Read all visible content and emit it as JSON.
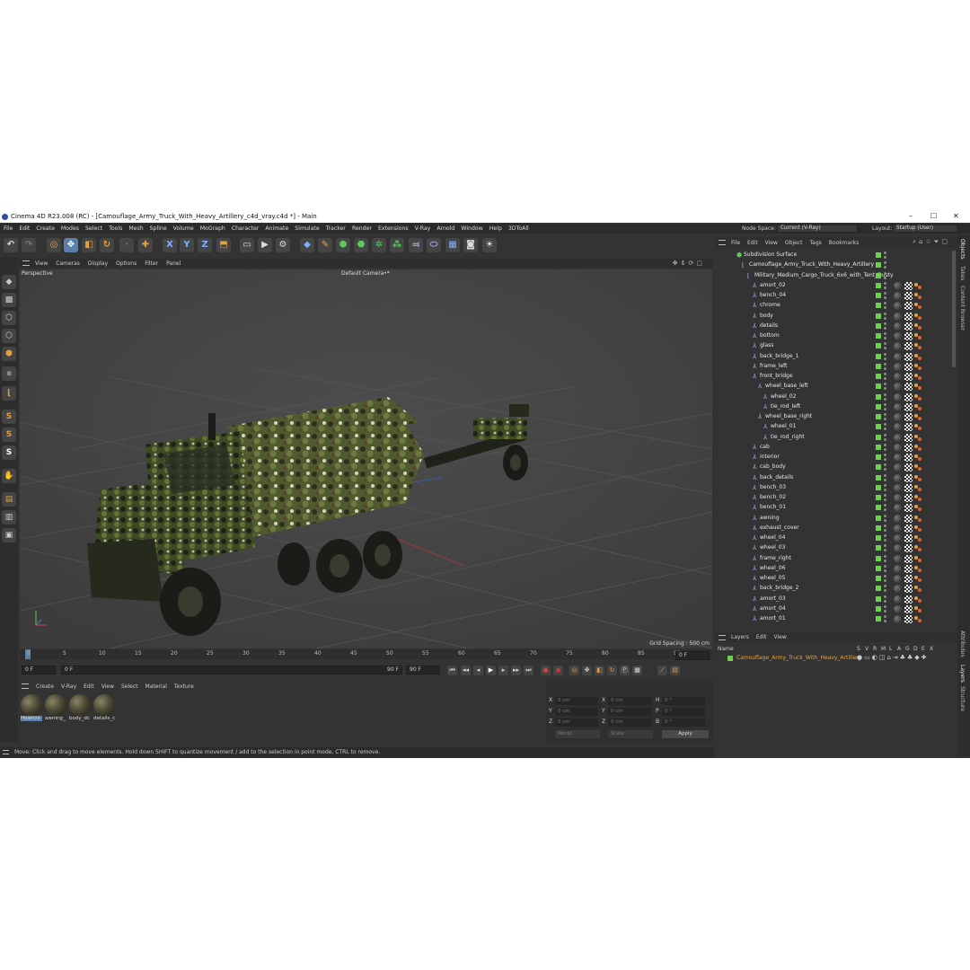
{
  "window": {
    "title": "Cinema 4D R23.008 (RC) - [Camouflage_Army_Truck_With_Heavy_Artillery_c4d_vray.c4d *] - Main",
    "minimize": "–",
    "maximize": "☐",
    "close": "✕"
  },
  "menu": [
    "File",
    "Edit",
    "Create",
    "Modes",
    "Select",
    "Tools",
    "Mesh",
    "Spline",
    "Volume",
    "MoGraph",
    "Character",
    "Animate",
    "Simulate",
    "Tracker",
    "Render",
    "Extensions",
    "V-Ray",
    "Arnold",
    "Window",
    "Help",
    "3DToAll"
  ],
  "node_space": {
    "label": "Node Space:",
    "value": "Current (V-Ray)"
  },
  "layout": {
    "label": "Layout:",
    "value": "Startup (User)"
  },
  "viewport": {
    "menu": [
      "View",
      "Cameras",
      "Display",
      "Options",
      "Filter",
      "Panel"
    ],
    "mode": "Perspective",
    "camera": "Default Camera",
    "camera_suffix": "•*",
    "grid_spacing": "Grid Spacing : 500 cm"
  },
  "timeline": {
    "ticks": [
      "0",
      "5",
      "10",
      "15",
      "20",
      "25",
      "30",
      "35",
      "40",
      "45",
      "50",
      "55",
      "60",
      "65",
      "70",
      "75",
      "80",
      "85",
      "90"
    ],
    "current_frame": "0 F",
    "start_field": "0 F",
    "start_slider": "0 F",
    "end_slider": "90 F",
    "end_field": "90 F",
    "right_field": "0 F"
  },
  "materials": {
    "menu": [
      "Create",
      "V-Ray",
      "Edit",
      "View",
      "Select",
      "Material",
      "Texture"
    ],
    "items": [
      "Howitze",
      "awning_",
      "body_dc",
      "details_c"
    ]
  },
  "coords": {
    "labels_left": [
      "X",
      "Y",
      "Z"
    ],
    "labels_mid": [
      "X",
      "Y",
      "Z"
    ],
    "labels_right": [
      "H",
      "P",
      "B"
    ],
    "pos": [
      "0 cm",
      "0 cm",
      "0 cm"
    ],
    "size": [
      "0 cm",
      "0 cm",
      "0 cm"
    ],
    "rot": [
      "0 °",
      "0 °",
      "0 °"
    ],
    "world": "World",
    "scale": "Scale",
    "apply": "Apply"
  },
  "status": "Move: Click and drag to move elements. Hold down SHIFT to quantize movement / add to the selection in point mode, CTRL to remove.",
  "objects": {
    "menu": [
      "File",
      "Edit",
      "View",
      "Object",
      "Tags",
      "Bookmarks"
    ],
    "rows": [
      {
        "name": "Subdivision Surface",
        "indent": 0,
        "tags": false
      },
      {
        "name": "Camouflage_Army_Truck_With_Heavy_Artillery",
        "indent": 1,
        "tags": false
      },
      {
        "name": "Military_Medium_Cargo_Truck_6x6_with_Tent_Dusty",
        "indent": 2,
        "tags": false
      },
      {
        "name": "amort_02",
        "indent": 3,
        "tags": true
      },
      {
        "name": "bench_04",
        "indent": 3,
        "tags": true
      },
      {
        "name": "chrome",
        "indent": 3,
        "tags": true
      },
      {
        "name": "body",
        "indent": 3,
        "tags": true
      },
      {
        "name": "details",
        "indent": 3,
        "tags": true
      },
      {
        "name": "bottom",
        "indent": 3,
        "tags": true
      },
      {
        "name": "glass",
        "indent": 3,
        "tags": true
      },
      {
        "name": "back_bridge_1",
        "indent": 3,
        "tags": true
      },
      {
        "name": "frame_left",
        "indent": 3,
        "tags": true
      },
      {
        "name": "front_bridge",
        "indent": 3,
        "tags": true
      },
      {
        "name": "wheel_base_left",
        "indent": 4,
        "tags": true
      },
      {
        "name": "wheel_02",
        "indent": 5,
        "tags": true
      },
      {
        "name": "tie_rod_left",
        "indent": 5,
        "tags": true
      },
      {
        "name": "wheel_base_right",
        "indent": 4,
        "tags": true
      },
      {
        "name": "wheel_01",
        "indent": 5,
        "tags": true
      },
      {
        "name": "tie_rod_right",
        "indent": 5,
        "tags": true
      },
      {
        "name": "cab",
        "indent": 3,
        "tags": true
      },
      {
        "name": "interior",
        "indent": 3,
        "tags": true
      },
      {
        "name": "cab_body",
        "indent": 3,
        "tags": true
      },
      {
        "name": "back_details",
        "indent": 3,
        "tags": true
      },
      {
        "name": "bench_03",
        "indent": 3,
        "tags": true
      },
      {
        "name": "bench_02",
        "indent": 3,
        "tags": true
      },
      {
        "name": "bench_01",
        "indent": 3,
        "tags": true
      },
      {
        "name": "awning",
        "indent": 3,
        "tags": true
      },
      {
        "name": "exhaust_cover",
        "indent": 3,
        "tags": true
      },
      {
        "name": "wheel_04",
        "indent": 3,
        "tags": true
      },
      {
        "name": "wheel_03",
        "indent": 3,
        "tags": true
      },
      {
        "name": "frame_right",
        "indent": 3,
        "tags": true
      },
      {
        "name": "wheel_06",
        "indent": 3,
        "tags": true
      },
      {
        "name": "wheel_05",
        "indent": 3,
        "tags": true
      },
      {
        "name": "back_bridge_2",
        "indent": 3,
        "tags": true
      },
      {
        "name": "amort_03",
        "indent": 3,
        "tags": true
      },
      {
        "name": "amort_04",
        "indent": 3,
        "tags": true
      },
      {
        "name": "amort_01",
        "indent": 3,
        "tags": true
      }
    ]
  },
  "layers": {
    "menu": [
      "Layers",
      "Edit",
      "View"
    ],
    "header_name": "Name",
    "header_flags": [
      "S",
      "V",
      "R",
      "M",
      "L",
      "A",
      "G",
      "D",
      "E",
      "X"
    ],
    "row": "Camouflage_Army_Truck_With_Heavy_Artillery"
  },
  "side_tabs": [
    "Objects",
    "Takes",
    "Content Browser",
    "Attributes",
    "Layers",
    "Structure"
  ],
  "colors": {
    "accent": "#e8a33a",
    "check": "#6bd14f",
    "layer_text": "#e8a33a",
    "selection": "#5b7fa8"
  }
}
